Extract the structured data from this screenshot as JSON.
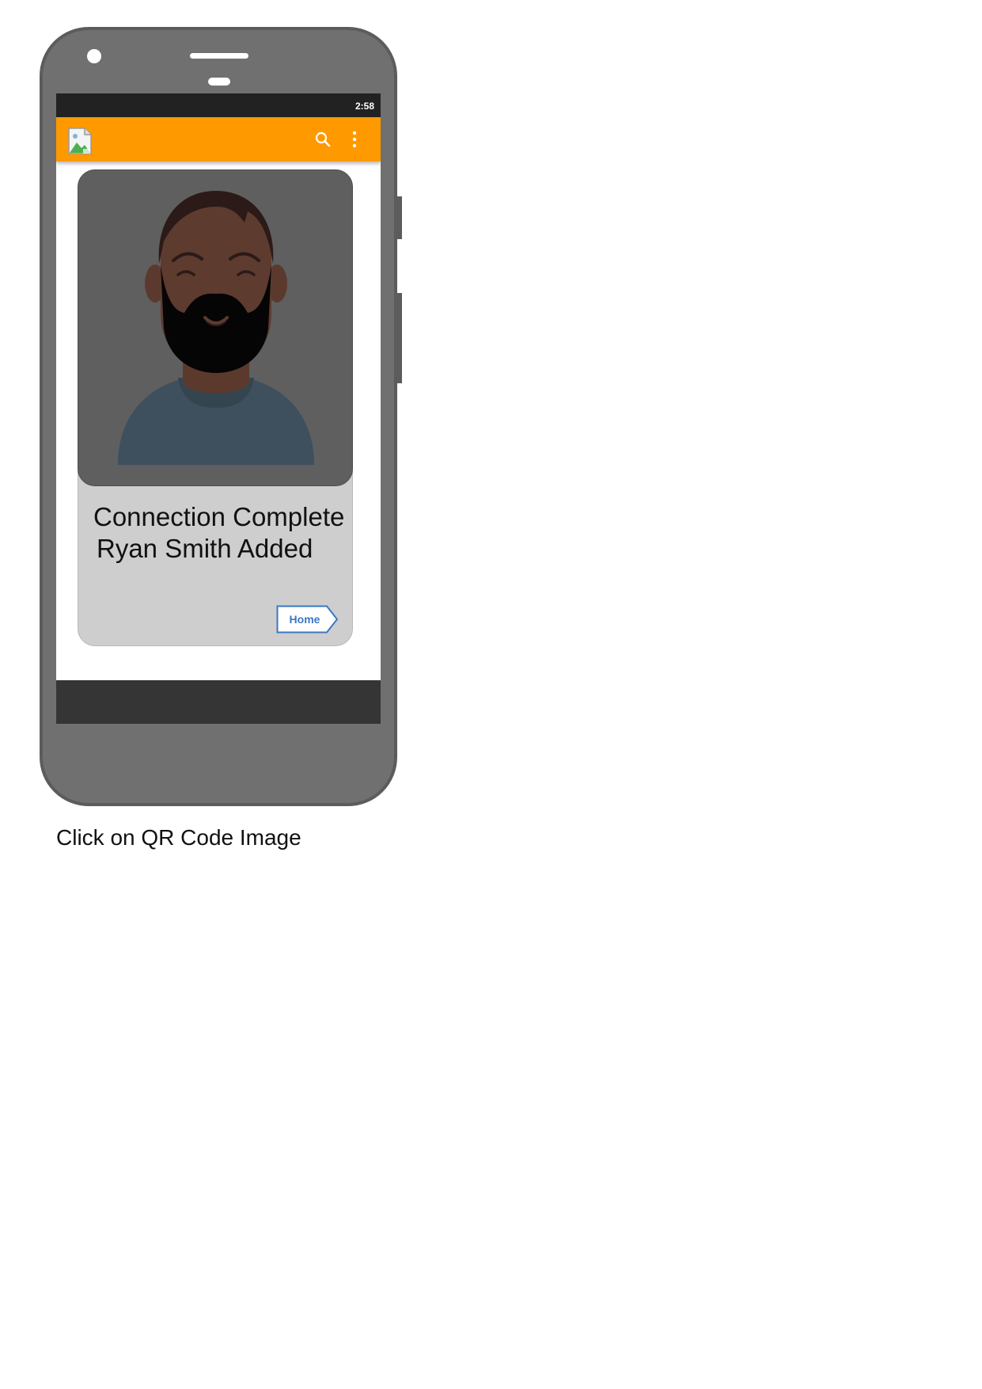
{
  "status_bar": {
    "time": "2:58"
  },
  "app_bar": {
    "logo_icon": "broken-image-icon",
    "actions": [
      {
        "icon": "search-icon"
      },
      {
        "icon": "more-vert-icon"
      }
    ],
    "background_color": "#ff9900"
  },
  "card": {
    "avatar_icon": "bearded-man-avatar",
    "message_line_1": "Connection Complete",
    "message_line_2": "Ryan Smith Added",
    "home_button_label": "Home"
  },
  "caption": "Click on QR Code Image"
}
